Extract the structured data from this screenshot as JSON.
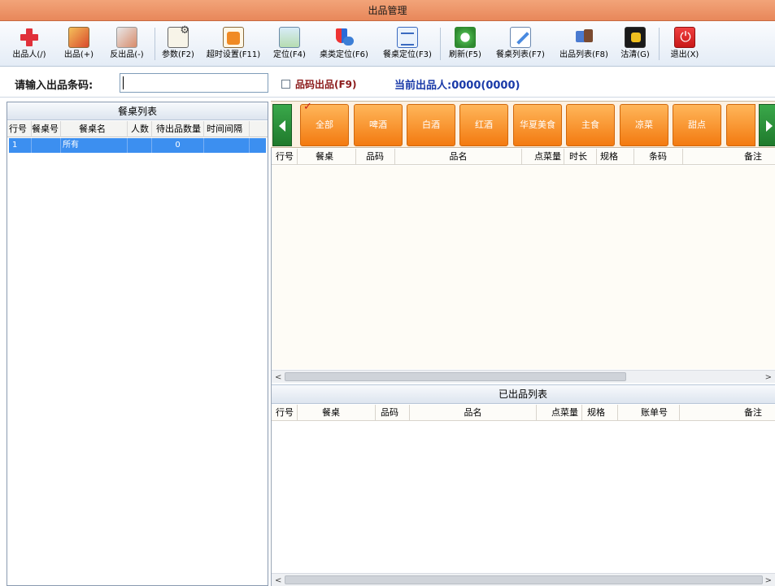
{
  "window": {
    "title": "出品管理"
  },
  "toolbar": {
    "buttons": [
      {
        "label": "出品人(/)",
        "icon": "plus-icon"
      },
      {
        "label": "出品(+)",
        "icon": "picture-icon"
      },
      {
        "label": "反出品(-)",
        "icon": "picture-undo-icon"
      },
      {
        "label": "参数(F2)",
        "icon": "settings-doc-icon"
      },
      {
        "label": "超时设置(F11)",
        "icon": "rss-doc-icon"
      },
      {
        "label": "定位(F4)",
        "icon": "map-icon"
      },
      {
        "label": "桌类定位(F6)",
        "icon": "shield-icon"
      },
      {
        "label": "餐桌定位(F3)",
        "icon": "list-icon"
      },
      {
        "label": "刷新(F5)",
        "icon": "refresh-icon"
      },
      {
        "label": "餐桌列表(F7)",
        "icon": "pencil-icon"
      },
      {
        "label": "出品列表(F8)",
        "icon": "puzzle-icon"
      },
      {
        "label": "沽清(G)",
        "icon": "hand-icon"
      },
      {
        "label": "退出(X)",
        "icon": "power-icon"
      }
    ]
  },
  "inputbar": {
    "barcode_label": "请输入出品条码:",
    "barcode_value": "",
    "checkbox_label": "品码出品(F9)",
    "current_user": "当前出品人:0000(0000)"
  },
  "left_panel": {
    "title": "餐桌列表",
    "columns": [
      "行号",
      "餐桌号",
      "餐桌名",
      "人数",
      "待出品数量",
      "时间间隔"
    ],
    "rows": [
      {
        "row_no": "1",
        "table_no": "",
        "table_name": "所有",
        "people": "",
        "pending": "0",
        "interval": ""
      }
    ]
  },
  "categories": {
    "items": [
      "全部",
      "啤酒",
      "白酒",
      "红酒",
      "华夏美食",
      "主食",
      "凉菜",
      "甜点",
      ""
    ],
    "selected_index": 0
  },
  "pending_table": {
    "columns": [
      "行号",
      "餐桌",
      "品码",
      "品名",
      "点菜量",
      "时长",
      "规格",
      "条码",
      "备注"
    ]
  },
  "served_list": {
    "title": "已出品列表",
    "columns": [
      "行号",
      "餐桌",
      "品码",
      "品名",
      "点菜量",
      "规格",
      "账单号",
      "备注"
    ]
  },
  "scrollbars": {
    "left_arrow": "<",
    "right_arrow": ">"
  },
  "colors": {
    "titlebar": "#e8875a",
    "category_button": "#f37a10",
    "nav_button": "#2a8a3a",
    "selection": "#3c8ff0",
    "current_user_text": "#1a3aa8",
    "checkbox_text": "#8b1a1a"
  }
}
